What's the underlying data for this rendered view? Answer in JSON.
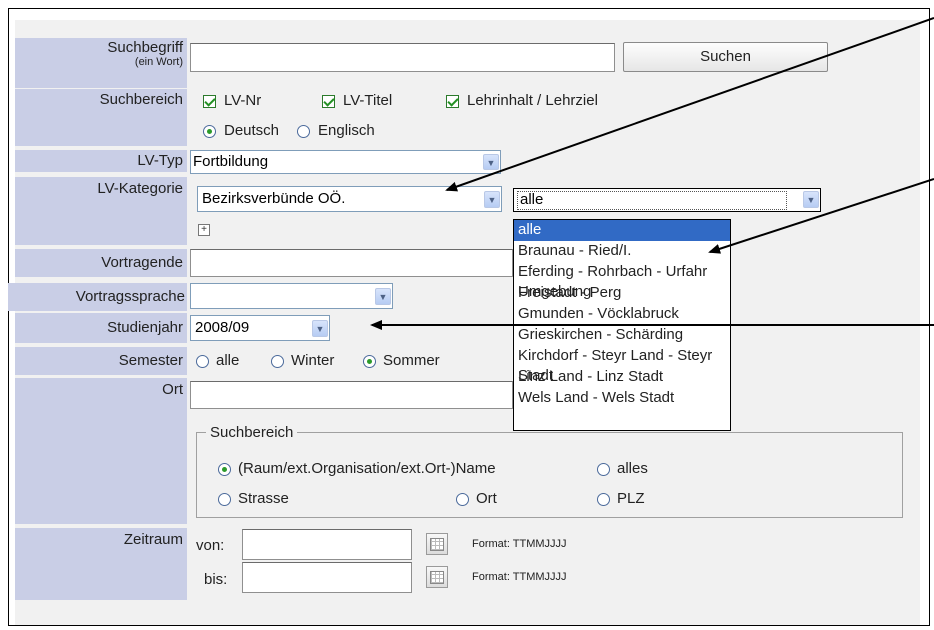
{
  "labels": {
    "suchbegriff": "Suchbegriff",
    "suchbegriff_sub": "(ein Wort)",
    "suchbereich": "Suchbereich",
    "lv_typ": "LV-Typ",
    "lv_kategorie": "LV-Kategorie",
    "vortragende": "Vortragende",
    "vortragssprache": "Vortragssprache",
    "studienjahr": "Studienjahr",
    "semester": "Semester",
    "ort": "Ort",
    "zeitraum": "Zeitraum"
  },
  "search": {
    "value": "",
    "button": "Suchen"
  },
  "suchbereich": {
    "checkboxes": [
      "LV-Nr",
      "LV-Titel",
      "Lehrinhalt / Lehrziel"
    ],
    "languages": [
      "Deutsch",
      "Englisch"
    ],
    "selected_language": "Deutsch"
  },
  "lv_typ": {
    "value": "Fortbildung"
  },
  "lv_kategorie": {
    "value": "Bezirksverbünde OÖ.",
    "sub_value": "alle",
    "options": [
      "alle",
      "Braunau - Ried/I.",
      "Eferding - Rohrbach - Urfahr Umgebung",
      "Freistadt - Perg",
      "Gmunden - Vöcklabruck",
      "Grieskirchen - Schärding",
      "Kirchdorf - Steyr Land - Steyr Stadt",
      "Linz Land - Linz Stadt",
      "Wels Land - Wels Stadt"
    ],
    "highlighted": "alle"
  },
  "studienjahr": {
    "value": "2008/09"
  },
  "semester": {
    "options": [
      "alle",
      "Winter",
      "Sommer"
    ],
    "selected": "Sommer"
  },
  "ort": {
    "legend": "Suchbereich",
    "options": [
      "(Raum/ext.Organisation/ext.Ort-)Name",
      "alles",
      "Strasse",
      "Ort",
      "PLZ"
    ],
    "selected": "(Raum/ext.Organisation/ext.Ort-)Name"
  },
  "zeitraum": {
    "von_label": "von:",
    "bis_label": "bis:",
    "format_text": "Format: TTMMJJJJ"
  }
}
